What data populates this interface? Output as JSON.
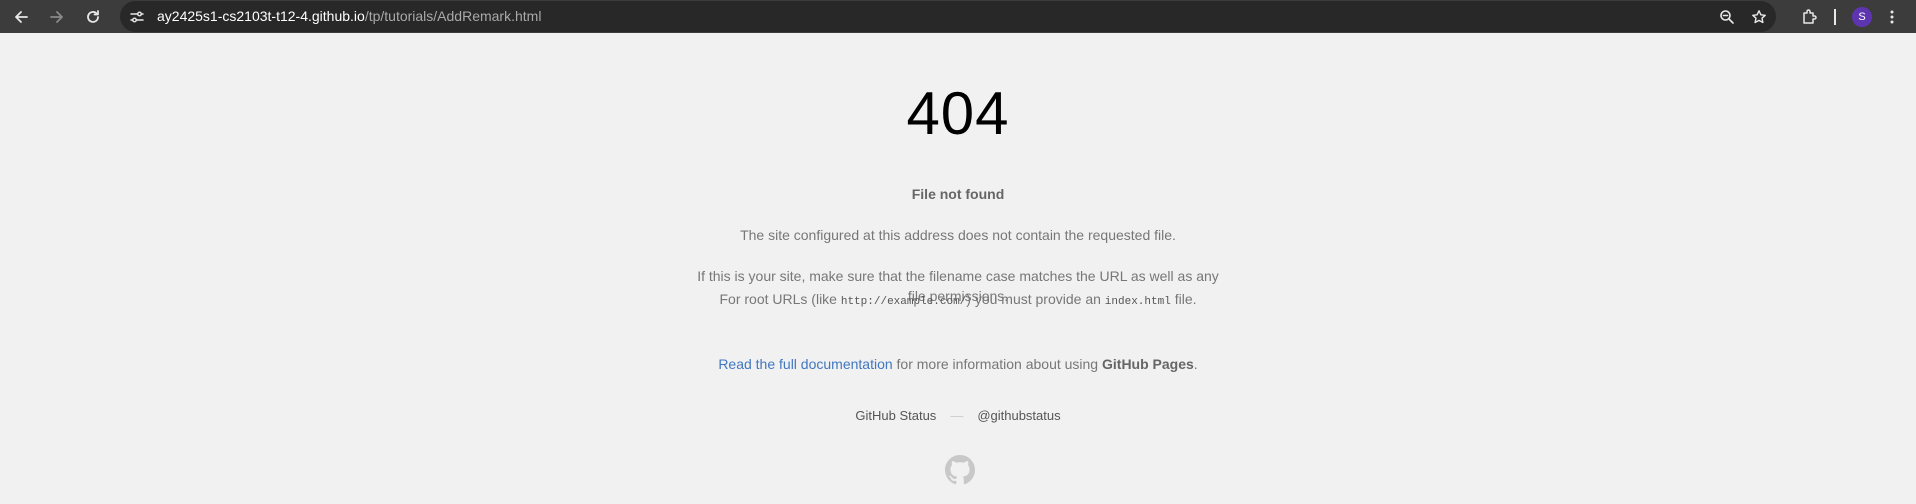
{
  "browser": {
    "url_host": "ay2425s1-cs2103t-t12-4.github.io",
    "url_path": "/tp/tutorials/AddRemark.html",
    "profile_initial": "S",
    "icons": [
      "back-arrow-icon",
      "forward-arrow-icon",
      "reload-icon",
      "site-settings-icon",
      "zoom-icon",
      "star-icon",
      "extensions-icon",
      "more-menu-icon"
    ]
  },
  "page": {
    "code": "404",
    "heading": "File not found",
    "paragraph1": "The site configured at this address does not contain the requested file.",
    "paragraph2": "If this is your site, make sure that the filename case matches the URL as well as any file permissions.",
    "p3_before": "For root URLs (like ",
    "p3_code1": "http://example.com/",
    "p3_middle": ") you must provide an ",
    "p3_code2": "index.html",
    "p3_after": " file.",
    "doc_link": "Read the full documentation",
    "p4_middle": " for more information about using ",
    "p4_strong": "GitHub Pages",
    "p4_end": ".",
    "footer_status": "GitHub Status",
    "footer_dash": "—",
    "footer_twitter": "@githubstatus"
  },
  "colors": {
    "toolbar": "#3c3c3c",
    "background": "#f1f1f1",
    "link": "#4078c0",
    "avatar": "#5e35b1"
  }
}
